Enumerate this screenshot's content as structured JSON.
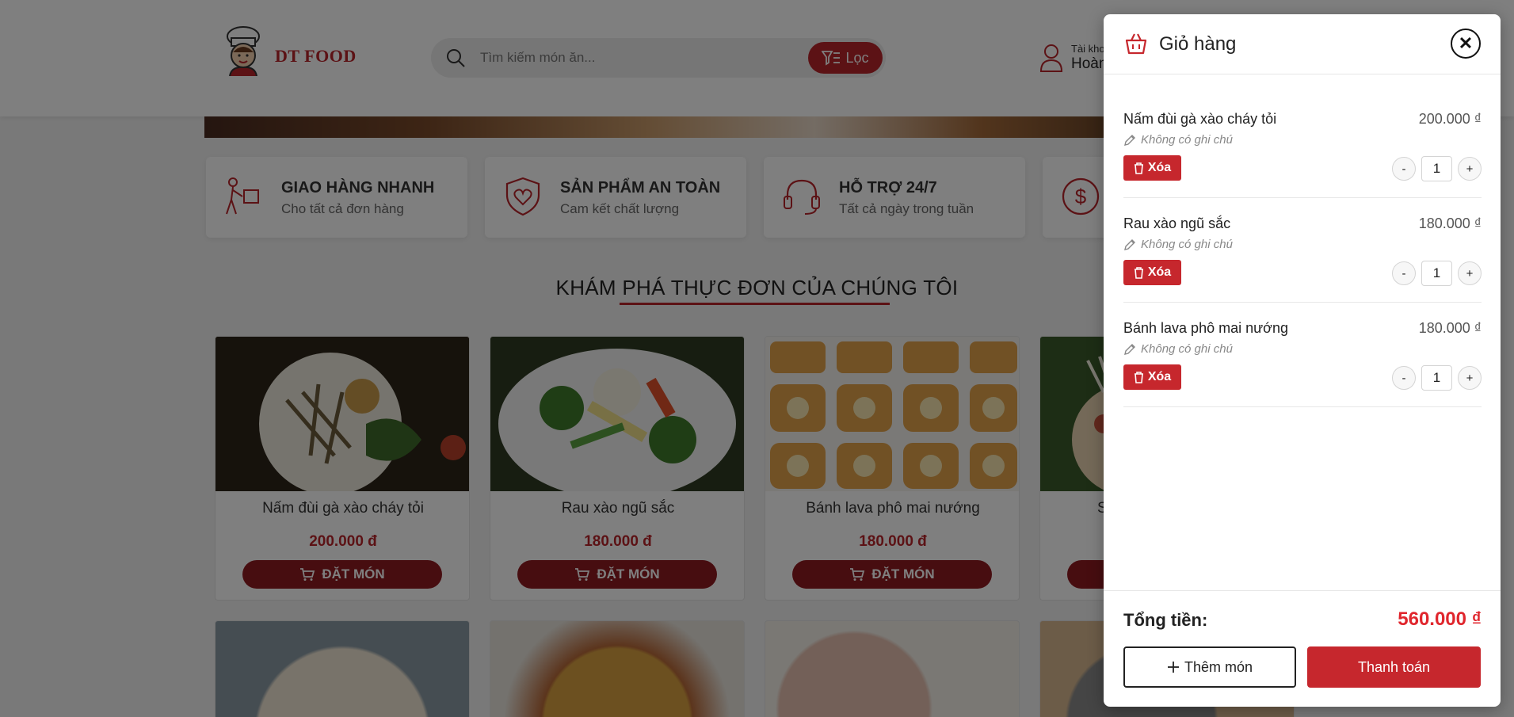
{
  "header": {
    "logo_text": "DT FOOD",
    "search_placeholder": "Tìm kiếm món ăn...",
    "filter_label": "Lọc",
    "account_label": "Tài kho",
    "account_name": "Hoàn"
  },
  "features": [
    {
      "title": "GIAO HÀNG NHANH",
      "subtitle": "Cho tất cả đơn hàng",
      "icon": "delivery-icon"
    },
    {
      "title": "SẢN PHẨM AN TOÀN",
      "subtitle": "Cam kết chất lượng",
      "icon": "shield-heart-icon"
    },
    {
      "title": "HỖ TRỢ 24/7",
      "subtitle": "Tất cả ngày trong tuần",
      "icon": "headset-icon"
    },
    {
      "title": "",
      "subtitle": "",
      "icon": "dollar-icon"
    }
  ],
  "section_title": "KHÁM PHÁ THỰC ĐƠN CỦA CHÚNG TÔI",
  "products": [
    {
      "name": "Nấm đùi gà xào cháy tỏi",
      "price": "200.000 đ",
      "button": "ĐẶT MÓN"
    },
    {
      "name": "Rau xào ngũ sắc",
      "price": "180.000 đ",
      "button": "ĐẶT MÓN"
    },
    {
      "name": "Bánh lava phô mai nướng",
      "price": "180.000 đ",
      "button": "ĐẶT MÓN"
    },
    {
      "name": "S",
      "price": "",
      "button": ""
    }
  ],
  "cart": {
    "title": "Giỏ hàng",
    "close_symbol": "✕",
    "items": [
      {
        "name": "Nấm đùi gà xào cháy tỏi",
        "price": "200.000 ₫",
        "note": "Không có ghi chú",
        "delete_label": "Xóa",
        "qty": "1"
      },
      {
        "name": "Rau xào ngũ sắc",
        "price": "180.000 ₫",
        "note": "Không có ghi chú",
        "delete_label": "Xóa",
        "qty": "1"
      },
      {
        "name": "Bánh lava phô mai nướng",
        "price": "180.000 ₫",
        "note": "Không có ghi chú",
        "delete_label": "Xóa",
        "qty": "1"
      }
    ],
    "minus_symbol": "-",
    "plus_symbol": "+",
    "total_label": "Tổng tiền:",
    "total_value": "560.000 ₫",
    "add_more_label": "Thêm món",
    "checkout_label": "Thanh toán"
  },
  "colors": {
    "brand_red": "#b8242b",
    "button_red": "#c6272d",
    "total_red": "#e0262d",
    "order_button": "#8f1a20"
  }
}
